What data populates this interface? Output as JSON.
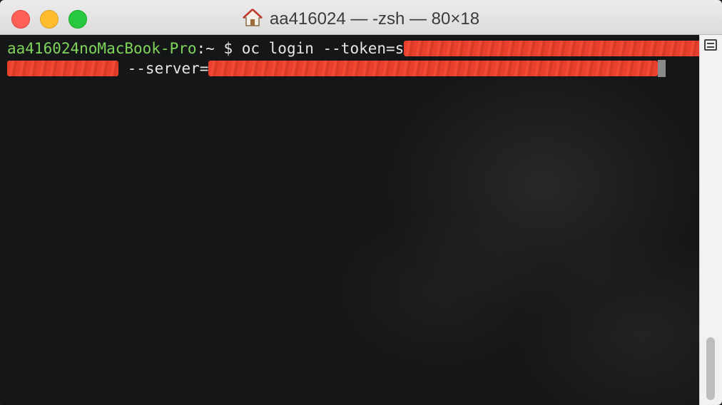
{
  "window": {
    "title": "aa416024 — -zsh — 80×18",
    "title_icon": "home-icon"
  },
  "terminal": {
    "prompt_host": "aa416024noMacBook-Pro",
    "prompt_rest": ":~ $ ",
    "command_part1": "oc login --token=s",
    "line2_prefix": "",
    "server_flag": " --server="
  },
  "colors": {
    "prompt_host": "#7fd45a",
    "redaction": "#e8402d",
    "close": "#fe5f57",
    "minimize": "#febc2e",
    "maximize": "#28c840"
  }
}
